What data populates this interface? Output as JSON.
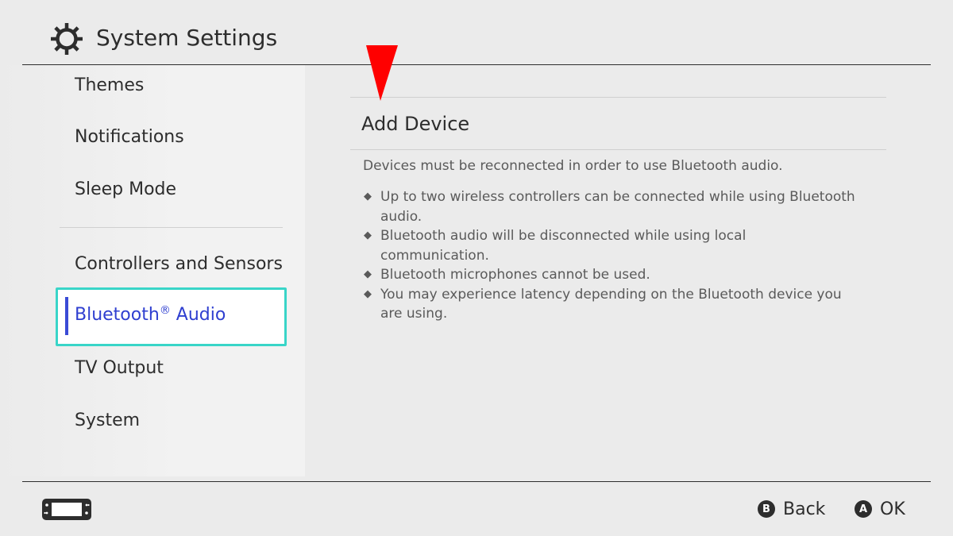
{
  "header": {
    "title": "System Settings",
    "icon": "gear-icon"
  },
  "sidebar": {
    "items": [
      {
        "label": "Themes"
      },
      {
        "label": "Notifications"
      },
      {
        "label": "Sleep Mode"
      },
      {
        "label": "Controllers and Sensors"
      },
      {
        "label": "Bluetooth",
        "label_mark": "®",
        "label_suffix": " Audio",
        "selected": true
      },
      {
        "label": "TV Output"
      },
      {
        "label": "System"
      }
    ],
    "selection_color": "#39d5c8",
    "selected_text_color": "#2f3fd0"
  },
  "main": {
    "pointer_icon": "red-down-arrow-icon",
    "pointer_color": "#ff0000",
    "option_label": "Add Device",
    "intro": "Devices must be reconnected in order to use Bluetooth audio.",
    "bullet_glyph": "◆",
    "notes": [
      "Up to two wireless controllers can be connected while using Bluetooth audio.",
      "Bluetooth audio will be disconnected while using local communication.",
      "Bluetooth microphones cannot be used.",
      "You may experience latency depending on the Bluetooth device you are using."
    ]
  },
  "footer": {
    "device_icon": "handheld-console-icon",
    "back": {
      "glyph": "B",
      "label": "Back"
    },
    "ok": {
      "glyph": "A",
      "label": "OK"
    }
  }
}
